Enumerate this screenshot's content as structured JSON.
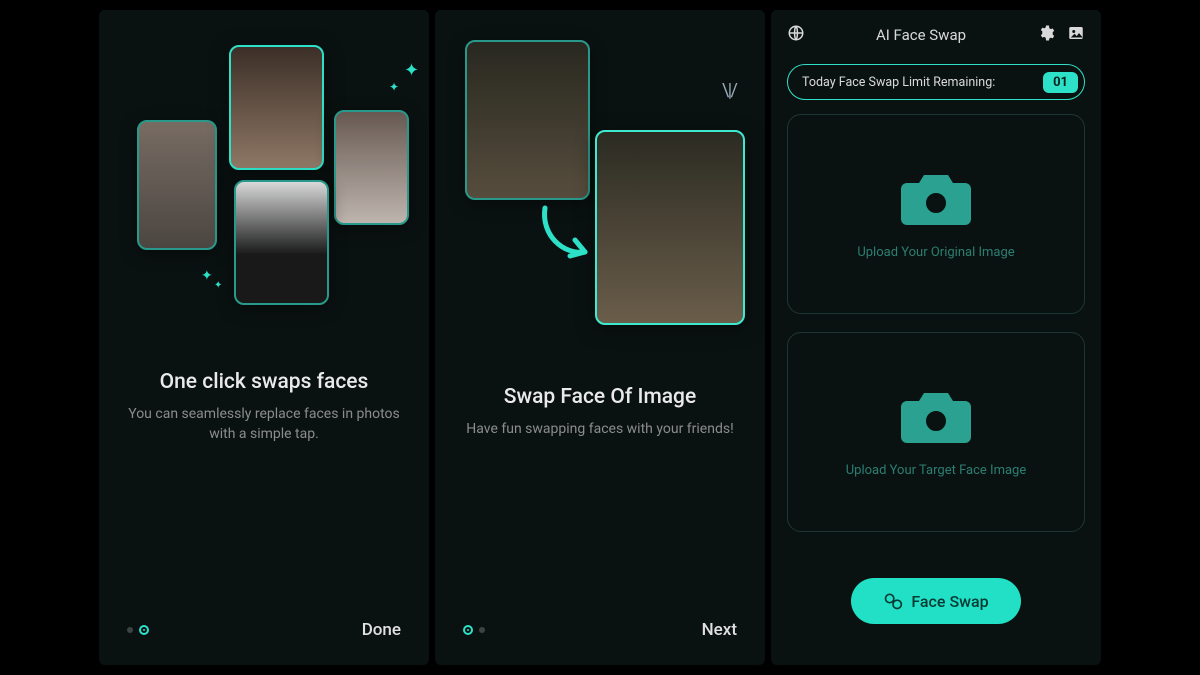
{
  "colors": {
    "accent": "#2de0c8",
    "bg": "#0a1211"
  },
  "screen1": {
    "title": "One click swaps faces",
    "subtitle": "You can seamlessly replace faces in photos with a simple tap.",
    "action": "Done"
  },
  "screen2": {
    "title": "Swap Face Of Image",
    "subtitle": "Have fun swapping faces with your friends!",
    "action": "Next"
  },
  "screen3": {
    "title": "AI Face Swap",
    "limit_label": "Today Face Swap Limit Remaining:",
    "limit_value": "01",
    "upload_original": "Upload Your Original Image",
    "upload_target": "Upload Your Target Face Image",
    "swap_button": "Face Swap"
  }
}
